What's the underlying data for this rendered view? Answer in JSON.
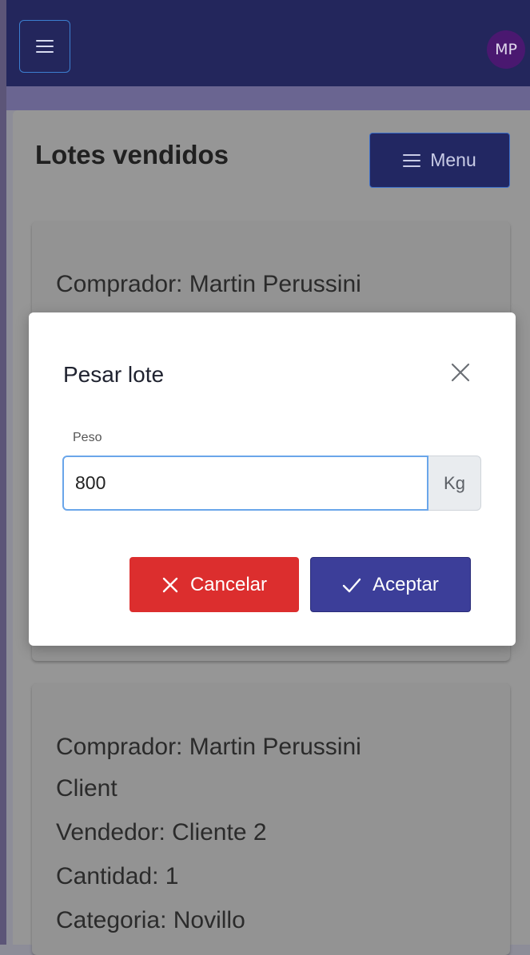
{
  "nav": {
    "avatar_initials": "MP"
  },
  "page": {
    "title": "Lotes vendidos",
    "menu_label": "Menu"
  },
  "cards": [
    {
      "lines": [
        "Comprador: Martin Perussini"
      ]
    },
    {
      "lines": [
        "Comprador: Martin Perussini",
        "Client",
        "Vendedor: Cliente 2",
        "Cantidad: 1",
        "Categoria: Novillo"
      ]
    }
  ],
  "modal": {
    "title": "Pesar lote",
    "field_label": "Peso",
    "weight_value": "800",
    "unit": "Kg",
    "cancel_label": "Cancelar",
    "accept_label": "Aceptar"
  },
  "colors": {
    "topbar": "#23265c",
    "cancel": "#dc2e2e",
    "accept": "#3c3e99"
  }
}
